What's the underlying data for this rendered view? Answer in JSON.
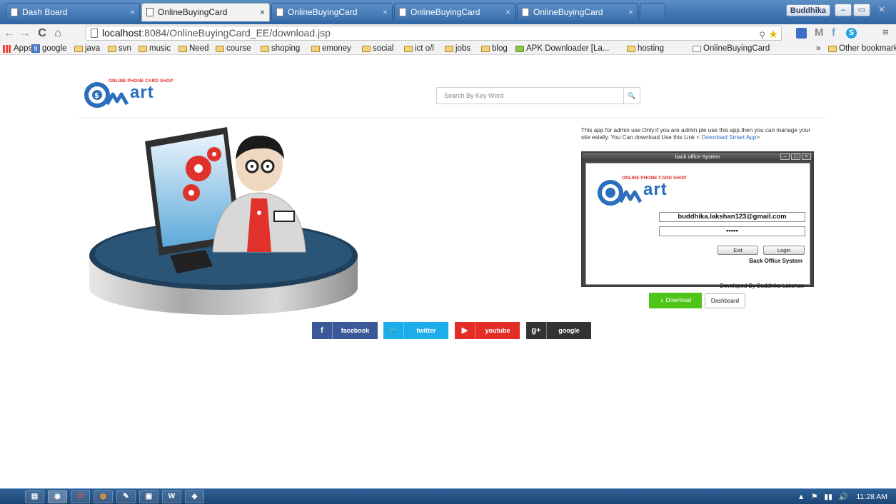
{
  "browser": {
    "tabs": [
      {
        "label": "Dash Board",
        "active": false
      },
      {
        "label": "OnlineBuyingCard",
        "active": true
      },
      {
        "label": "OnlineBuyingCard",
        "active": false
      },
      {
        "label": "OnlineBuyingCard",
        "active": false
      },
      {
        "label": "OnlineBuyingCard",
        "active": false
      }
    ],
    "user": "Buddhika",
    "url_host": "localhost",
    "url_path": ":8084/OnlineBuyingCard_EE/download.jsp",
    "bookmarks": [
      "Apps",
      "google",
      "java",
      "svn",
      "music",
      "Need",
      "course",
      "shoping",
      "emoney",
      "social",
      "ict o/l",
      "jobs",
      "blog",
      "APK Downloader [La...",
      "hosting",
      "OnlineBuyingCard"
    ],
    "other_bookmarks": "Other bookmarks",
    "overflow": "»"
  },
  "page": {
    "logo_tagline": "ONLINE PHONE CARD SHOP",
    "logo_word": "art",
    "search_placeholder": "Search By Key Word",
    "admin_info_text": "This app for admin use Only.if you are admin ple use this app.then you can manage your site esially. You Can download Use this Link < ",
    "admin_info_link": "Download Smart App",
    "admin_info_end": ">",
    "app_window": {
      "title": "back office System",
      "tagline": "ONLINE PHONE CARD SHOP",
      "email": "buddhika.lakshan123@gmail.com",
      "password": "•••••",
      "exit_label": "Exit",
      "login_label": "Login",
      "caption": "Back Office System",
      "developer": "Developed By Buddhika Lakshan"
    },
    "download_label": "Download",
    "dashboard_label": "Dashboard",
    "social": [
      {
        "icon": "f",
        "label": "facebook",
        "color": "#3b5998"
      },
      {
        "icon": "🐦",
        "label": "twitter",
        "color": "#1dadeb"
      },
      {
        "icon": "▶",
        "label": "youtube",
        "color": "#e52d27"
      },
      {
        "icon": "g+",
        "label": "google",
        "color": "#333333"
      }
    ]
  },
  "taskbar": {
    "clock": "11:28 AM"
  },
  "colors": {
    "brand_blue": "#2a6ebd",
    "brand_red": "#e0312a",
    "download_green": "#4fc51a"
  }
}
